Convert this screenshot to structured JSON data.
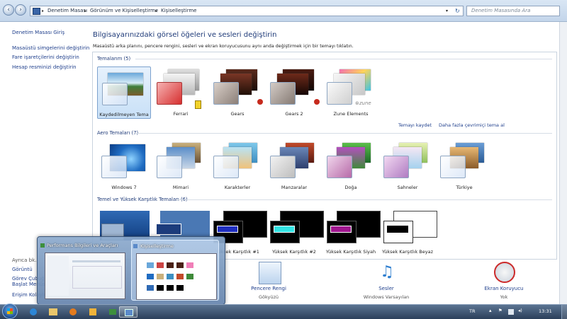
{
  "breadcrumb": {
    "items": [
      "Denetim Masası",
      "Görünüm ve Kişiselleştirme",
      "Kişiselleştirme"
    ]
  },
  "search": {
    "placeholder": "Denetim Masasında Ara"
  },
  "sidebar": {
    "home": "Denetim Masası Giriş",
    "links": [
      "Masaüstü simgelerini değiştirin",
      "Fare işaretçilerini değiştirin",
      "Hesap resminizi değiştirin"
    ],
    "see_also_title": "Ayrıca bk.",
    "see_also": [
      "Görüntü",
      "Görev Çubuğu ve Başlat Menüsü",
      "Erişim Kolaylığı Merkezi"
    ]
  },
  "main": {
    "title": "Bilgisayarınızdaki görsel öğeleri ve sesleri değiştirin",
    "subtitle": "Masaüstü arka planını, pencere rengini, sesleri ve ekran koruyucusunu aynı anda değiştirmek için bir temayı tıklatın.",
    "my_themes": {
      "title": "Temalarım (5)",
      "items": [
        "Kaydedilmeyen Tema",
        "Ferrari",
        "Gears",
        "Gears 2",
        "Zune Elements"
      ],
      "save_link": "Temayı kaydet",
      "online_link": "Daha fazla çevrimiçi tema al"
    },
    "aero_themes": {
      "title": "Aero Temaları (7)",
      "items": [
        "Windows 7",
        "Mimari",
        "Karakterler",
        "Manzaralar",
        "Doğa",
        "Sahneler",
        "Türkiye"
      ]
    },
    "basic_themes": {
      "title": "Temel ve Yüksek Karşıtlık Temaları (6)",
      "items": [
        "",
        "",
        "Yüksek Karşıtlık #1",
        "Yüksek Karşıtlık #2",
        "Yüksek Karşıtlık Siyah",
        "Yüksek Karşıtlık Beyaz"
      ]
    }
  },
  "bottom": {
    "color_label": "Pencere Rengi",
    "color_value": "Gökyüzü",
    "sound_label": "Sesler",
    "sound_value": "Windows Varsayılan",
    "saver_label": "Ekran Koruyucu",
    "saver_value": "Yok"
  },
  "popup": {
    "windows": [
      "Performans Bilgileri ve Araçları",
      "Kişiselleştirme"
    ]
  },
  "taskbar": {
    "language": "TR",
    "time": "13:31"
  }
}
